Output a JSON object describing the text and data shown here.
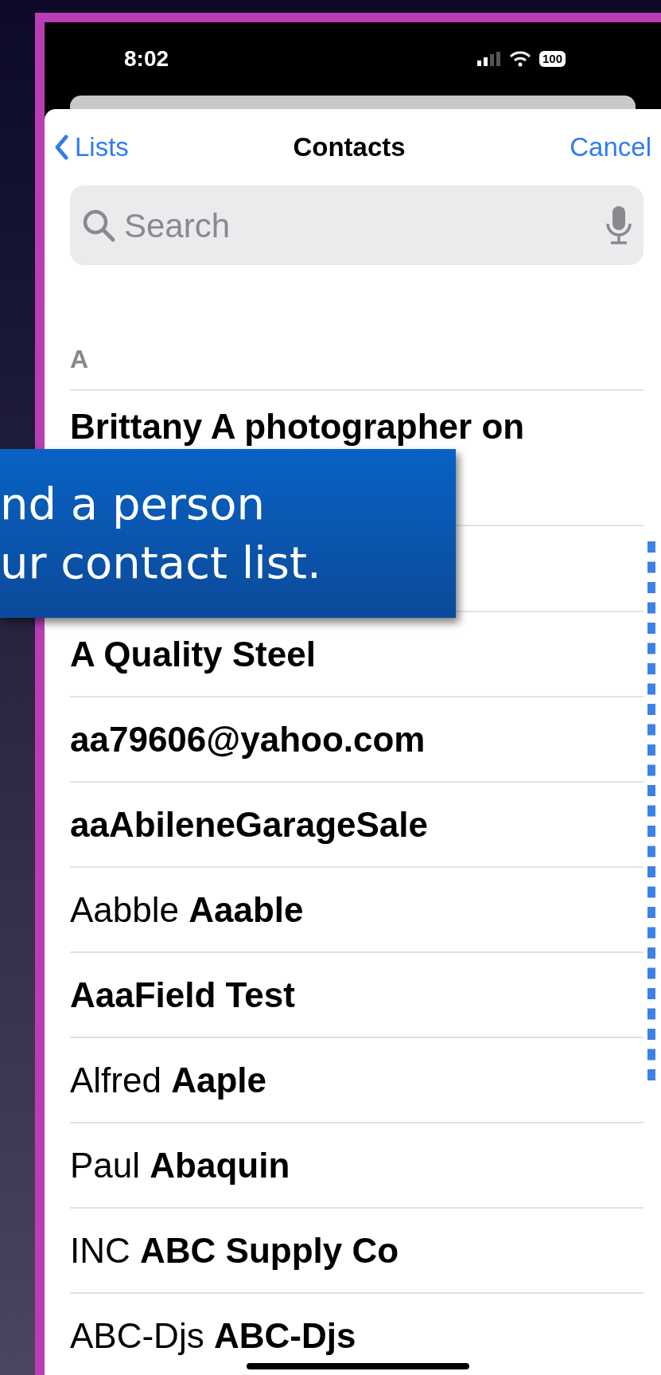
{
  "status_bar": {
    "time": "8:02",
    "battery": "100"
  },
  "nav": {
    "back": "Lists",
    "title": "Contacts",
    "action": "Cancel"
  },
  "search": {
    "placeholder": "Search"
  },
  "section": "A",
  "contacts": [
    {
      "name": "Brittany A photographer on",
      "bold": true,
      "kind": "wrapped"
    },
    {
      "name": "A Quality Steel",
      "bold": true,
      "kind": "single"
    },
    {
      "name": "aa79606@yahoo.com",
      "bold": true,
      "kind": "single"
    },
    {
      "name": "aaAbileneGarageSale",
      "bold": true,
      "kind": "single"
    },
    {
      "name": "Aabble **Aaable**",
      "bold": false,
      "kind": "single"
    },
    {
      "name": "AaaField Test",
      "bold": true,
      "kind": "single"
    },
    {
      "name": "Alfred **Aaple**",
      "bold": false,
      "kind": "single"
    },
    {
      "name": "Paul **Abaquin**",
      "bold": false,
      "kind": "single"
    },
    {
      "name": "INC **ABC Supply Co**",
      "bold": false,
      "kind": "single"
    },
    {
      "name": "ABC-Djs **ABC-Djs**",
      "bold": false,
      "kind": "single"
    }
  ],
  "callout": {
    "lines": [
      "nd a person",
      "ur contact list."
    ]
  }
}
